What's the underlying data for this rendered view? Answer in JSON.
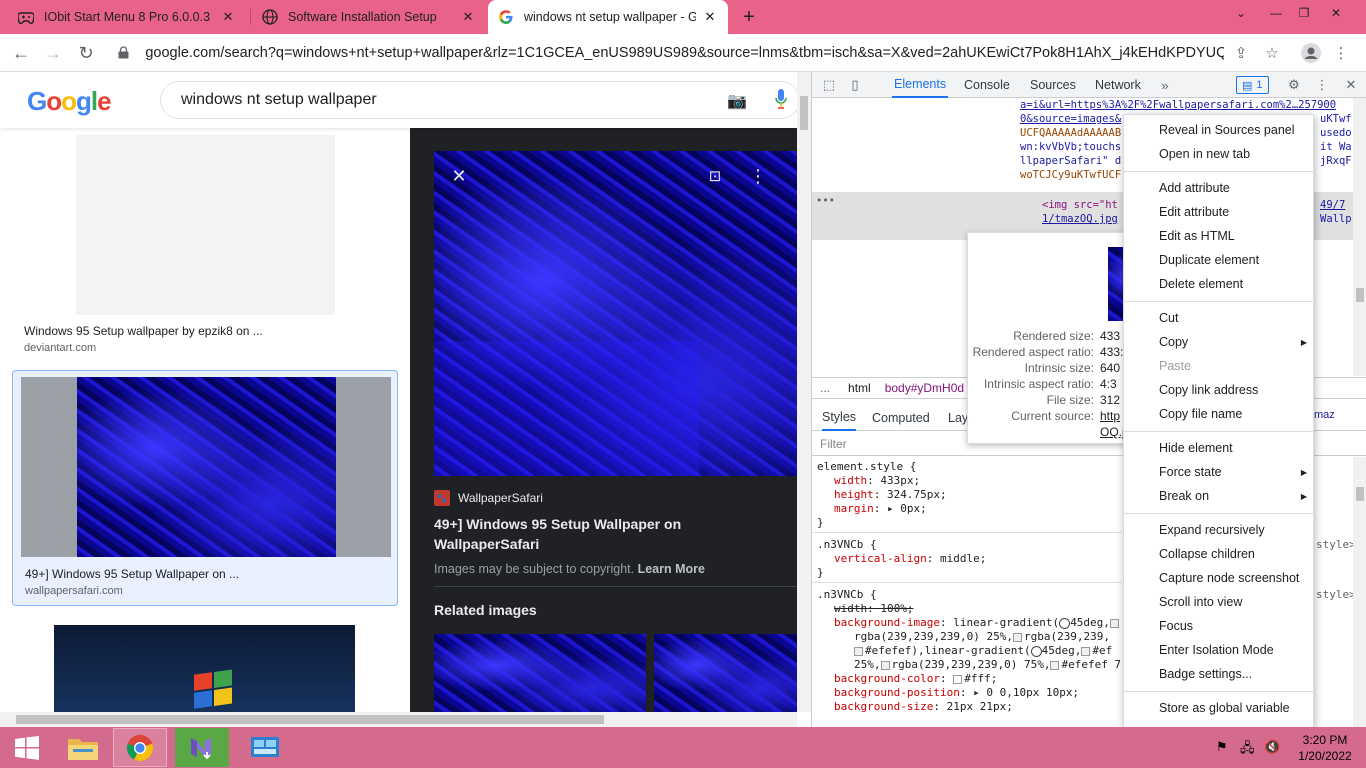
{
  "browser": {
    "tabs": [
      {
        "title": "IObit Start Menu 8 Pro 6.0.0.3 Cr",
        "icon": "gamepad-icon"
      },
      {
        "title": "Software Installation Setup",
        "icon": "globe-icon"
      },
      {
        "title": "windows nt setup wallpaper - Go",
        "icon": "google-icon",
        "active": true
      }
    ],
    "new_tab": "+",
    "url": "google.com/search?q=windows+nt+setup+wallpaper&rlz=1C1GCEA_enUS989US989&source=lnms&tbm=isch&sa=X&ved=2ahUKEwiCt7Pok8H1AhX_j4kEHdKPDYUQ_AUo..."
  },
  "google": {
    "logo": "Google",
    "query": "windows nt setup wallpaper",
    "results": [
      {
        "caption": "Windows 95 Setup wallpaper by epzik8 on ...",
        "source": "deviantart.com"
      },
      {
        "caption": "49+] Windows 95 Setup Wallpaper on ...",
        "source": "wallpapersafari.com"
      }
    ],
    "preview": {
      "site": "WallpaperSafari",
      "title": "49+] Windows 95 Setup Wallpaper on WallpaperSafari",
      "copyright": "Images may be subject to copyright.",
      "learn_more": "Learn More",
      "related": "Related images"
    }
  },
  "devtools": {
    "tabs": [
      "Elements",
      "Console",
      "Sources",
      "Network"
    ],
    "active_tab": "Elements",
    "issues_count": "1",
    "dom_lines": [
      "a=i&url=https%3A%2F%2Fwallpapersafari.com%2…257900",
      "0&source=images&",
      "UCFQAAAAAdAAAAAB",
      "wn:kvVbVb;touchs",
      "llpaperSafari\" d",
      "woTCJCy9uKTwfUCF",
      "<img src=\"ht",
      "1/tmazOQ.jpg"
    ],
    "dom_right": [
      "uKTwf",
      "usedo",
      "it Wa",
      "jRxqF",
      "49/7",
      "Wallp"
    ],
    "dom_ellipsis": "•••",
    "breadcrumbs": [
      "html",
      "body#yDmH0d"
    ],
    "breadcrumbs_prefix": "...",
    "subtabs": [
      "Styles",
      "Computed",
      "Lay"
    ],
    "filter_placeholder": "Filter",
    "css": {
      "element_style": "element.style {",
      "width": "433px;",
      "height": "324.75px;",
      "margin": "0px;",
      "sel1": ".n3VNCb {",
      "va": "middle;",
      "sel2": ".n3VNCb {",
      "width_struck": "width: 100%;",
      "bg_image_1": "linear-gradient(",
      "bg_image_2": "45deg,",
      "bg_line2": "rgba(239,239,239,0) 25%,",
      "bg_line2b": "rgba(239,239,",
      "bg_line3": "#efefef),linear-gradient(",
      "bg_line3b": "45deg,",
      "bg_line3c": "#ef",
      "bg_line4": "25%,",
      "bg_line4b": "rgba(239,239,239,0) 75%,",
      "bg_line4c": "#efefef 7",
      "bg_color": "#fff;",
      "bg_pos": "0 0,10px 10px;",
      "bg_size": "21px 21px;",
      "close": "}",
      "style_tag": "style>",
      "style_tag2": "style>"
    },
    "image_tooltip": [
      {
        "k": "Rendered size:",
        "v": "433"
      },
      {
        "k": "Rendered aspect ratio:",
        "v": "433:"
      },
      {
        "k": "Intrinsic size:",
        "v": "640"
      },
      {
        "k": "Intrinsic aspect ratio:",
        "v": "4:3"
      },
      {
        "k": "File size:",
        "v": "312"
      },
      {
        "k": "Current source:",
        "v": "http"
      },
      {
        "k": "",
        "v": "OQ.j"
      }
    ],
    "tooltip_right": "maz",
    "context_menu": [
      {
        "label": "Reveal in Sources panel"
      },
      {
        "label": "Open in new tab"
      },
      {
        "sep": true
      },
      {
        "label": "Add attribute"
      },
      {
        "label": "Edit attribute"
      },
      {
        "label": "Edit as HTML"
      },
      {
        "label": "Duplicate element"
      },
      {
        "label": "Delete element"
      },
      {
        "sep": true
      },
      {
        "label": "Cut"
      },
      {
        "label": "Copy",
        "submenu": true
      },
      {
        "label": "Paste",
        "disabled": true
      },
      {
        "label": "Copy link address"
      },
      {
        "label": "Copy file name"
      },
      {
        "sep": true
      },
      {
        "label": "Hide element"
      },
      {
        "label": "Force state",
        "submenu": true
      },
      {
        "label": "Break on",
        "submenu": true
      },
      {
        "sep": true
      },
      {
        "label": "Expand recursively"
      },
      {
        "label": "Collapse children"
      },
      {
        "label": "Capture node screenshot"
      },
      {
        "label": "Scroll into view"
      },
      {
        "label": "Focus"
      },
      {
        "label": "Enter Isolation Mode"
      },
      {
        "label": "Badge settings..."
      },
      {
        "sep": true
      },
      {
        "label": "Store as global variable"
      }
    ]
  },
  "taskbar": {
    "time": "3:20 PM",
    "date": "1/20/2022"
  }
}
